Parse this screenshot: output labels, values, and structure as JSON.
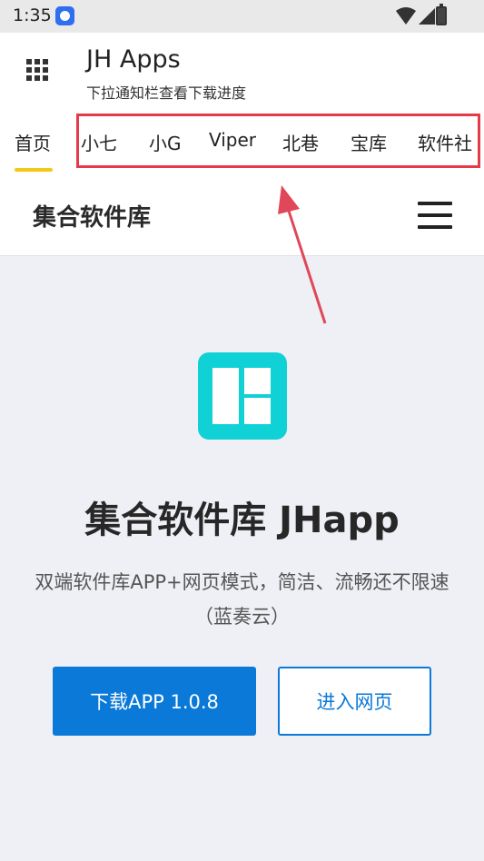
{
  "status_bar": {
    "time": "1:35",
    "app_icon": "browser-c-icon",
    "indicators": [
      "wifi-icon",
      "signal-icon",
      "battery-icon"
    ]
  },
  "header": {
    "title": "JH Apps",
    "subtitle": "下拉通知栏查看下载进度",
    "menu_icon": "grid-menu-icon"
  },
  "tabs": [
    {
      "label": "首页",
      "active": true
    },
    {
      "label": "小七"
    },
    {
      "label": "小G"
    },
    {
      "label": "Viper"
    },
    {
      "label": "北巷"
    },
    {
      "label": "宝库"
    },
    {
      "label": "软件社"
    }
  ],
  "annotation": {
    "highlight_color": "#e53b48",
    "arrow_color": "#e0485a"
  },
  "web": {
    "site_title": "集合软件库",
    "menu_icon": "hamburger-menu-icon",
    "hero": {
      "logo_icon": "app-grid-logo-icon",
      "logo_color": "#10d2d6",
      "title": "集合软件库 JHapp",
      "description": "双端软件库APP+网页模式，简洁、流畅还不限速（蓝奏云）"
    },
    "buttons": {
      "download": "下载APP 1.0.8",
      "enter_web": "进入网页",
      "accent": "#0a79d8"
    }
  }
}
